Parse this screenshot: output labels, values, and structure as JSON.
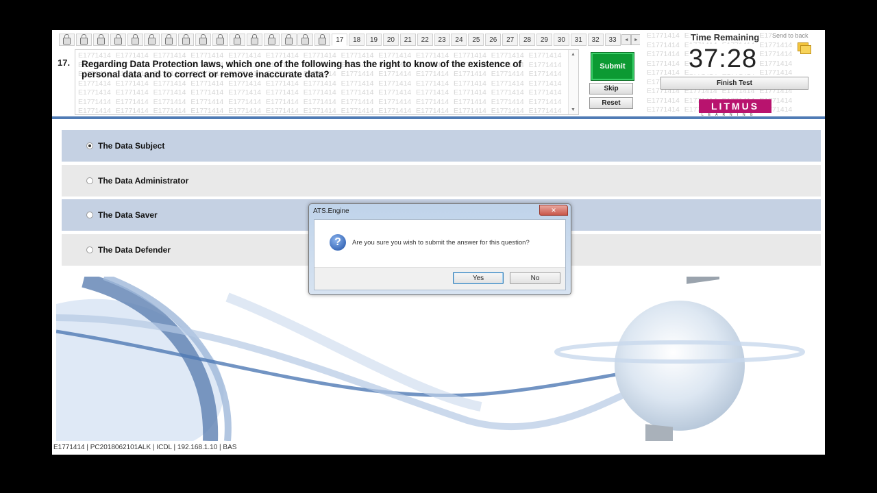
{
  "question_nav": {
    "locked_count": 16,
    "current": "17",
    "numbers": [
      "18",
      "19",
      "20",
      "21",
      "22",
      "23",
      "24",
      "25",
      "26",
      "27",
      "28",
      "29",
      "30",
      "31",
      "32",
      "33"
    ],
    "prev_arrow": "◄",
    "next_arrow": "►"
  },
  "question": {
    "number": "17.",
    "text": "Regarding Data Protection laws, which one of the following has the right to know of the existence of personal data and to correct or remove inaccurate data?",
    "watermark": "E1771414"
  },
  "actions": {
    "submit": "Submit",
    "skip": "Skip",
    "reset": "Reset",
    "finish": "Finish Test",
    "send_to_back": "Send to back"
  },
  "timer": {
    "label": "Time Remaining",
    "value": "37:28"
  },
  "brand": {
    "logo": "LITMUS",
    "sub": "LEARNING",
    "color": "#b8136e"
  },
  "options": [
    {
      "label": "The Data Subject",
      "selected": true
    },
    {
      "label": "The Data Administrator",
      "selected": false
    },
    {
      "label": "The Data Saver",
      "selected": false
    },
    {
      "label": "The Data Defender",
      "selected": false
    }
  ],
  "status_bar": "E1771414  |  PC2018062101ALK  |  ICDL  |  192.168.1.10  |  BAS",
  "dialog": {
    "title": "ATS.Engine",
    "message": "Are you sure you wish to submit the answer for this question?",
    "yes": "Yes",
    "no": "No",
    "icon": "question-icon"
  },
  "colors": {
    "accent_blue": "#4f7bb5",
    "submit_green": "#0c9a33",
    "option_blue": "#c5d1e3",
    "option_grey": "#e9e9e9"
  }
}
